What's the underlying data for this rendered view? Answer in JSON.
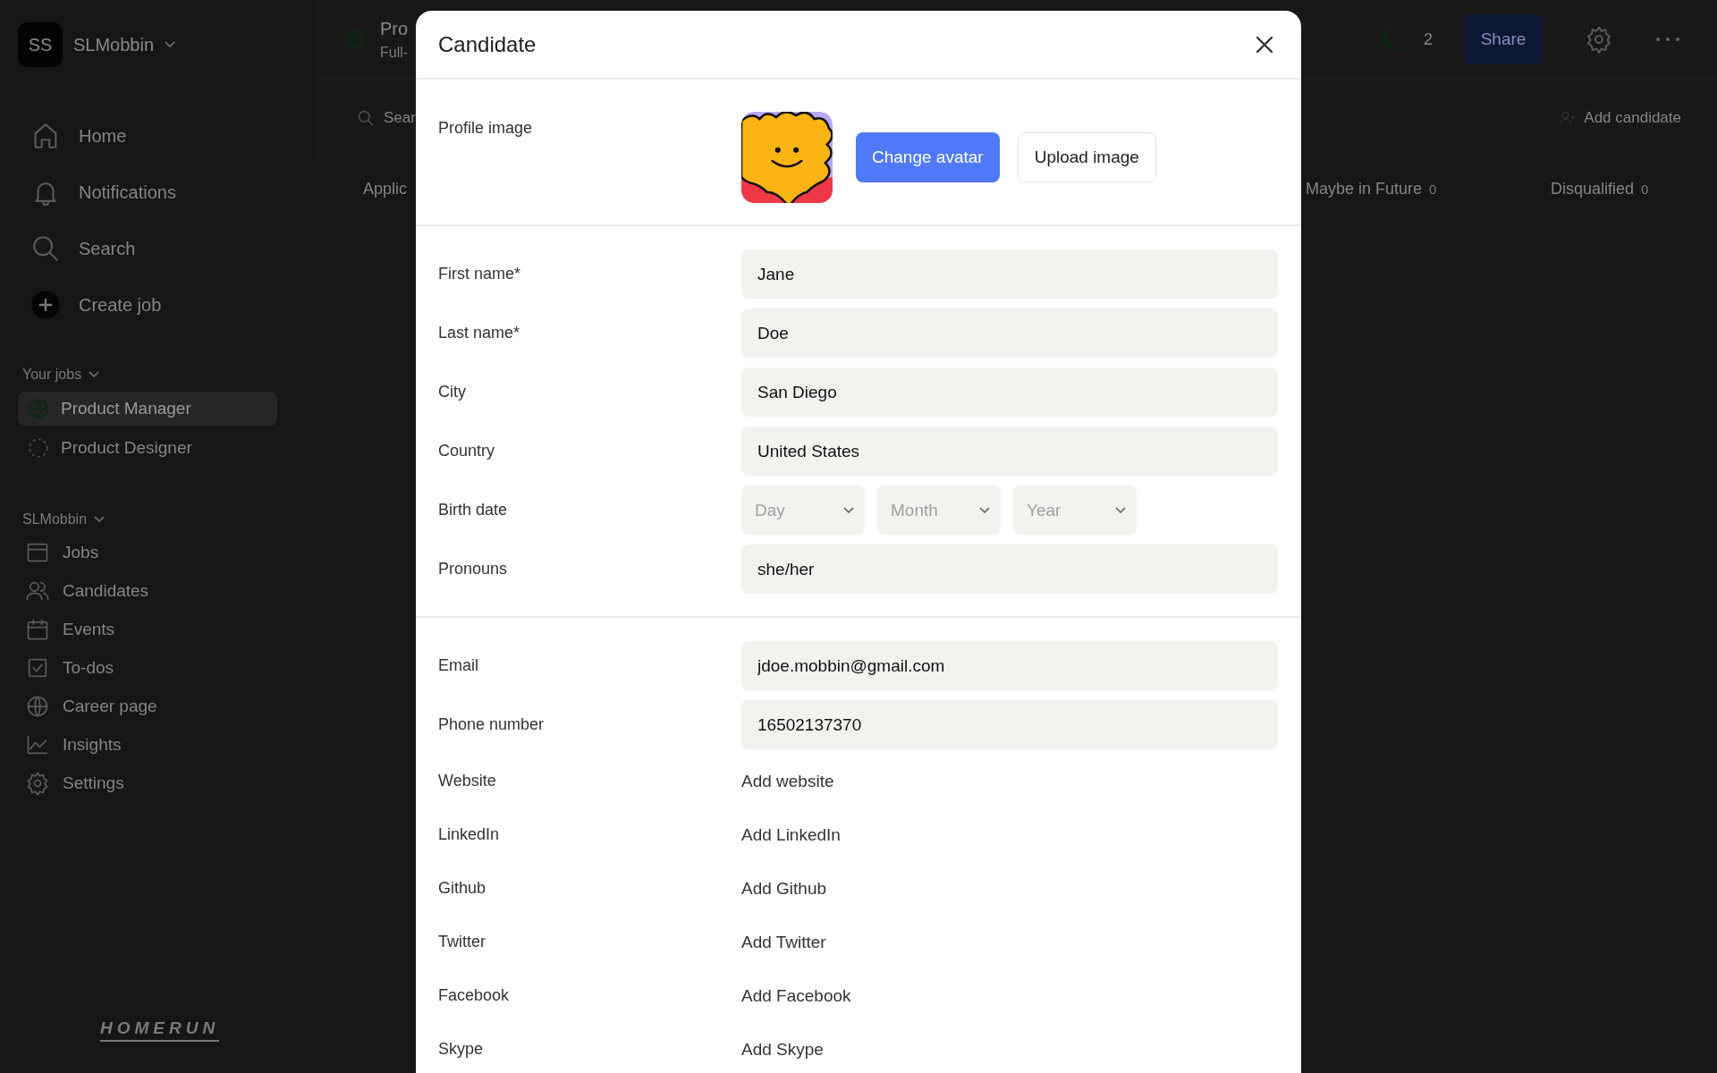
{
  "sidebar": {
    "workspace": {
      "initials": "SS",
      "name": "SLMobbin"
    },
    "nav": [
      {
        "label": "Home"
      },
      {
        "label": "Notifications"
      },
      {
        "label": "Search"
      },
      {
        "label": "Create job"
      }
    ],
    "jobs_heading": "Your jobs",
    "jobs": [
      {
        "title": "Product Manager",
        "selected": true
      },
      {
        "title": "Product Designer",
        "selected": false
      }
    ],
    "org_heading": "SLMobbin",
    "org_nav": [
      {
        "label": "Jobs"
      },
      {
        "label": "Candidates"
      },
      {
        "label": "Events"
      },
      {
        "label": "To-dos"
      },
      {
        "label": "Career page"
      },
      {
        "label": "Insights"
      },
      {
        "label": "Settings"
      }
    ],
    "brand": "HOMERUN"
  },
  "header": {
    "job_title": "Pro",
    "job_subtitle": "Full-",
    "badge_count": "2",
    "share": "Share"
  },
  "toolbar": {
    "search_placeholder": "Sear",
    "add_candidate": "Add candidate"
  },
  "columns": [
    {
      "label": "Applic"
    },
    {
      "label": "Maybe in Future",
      "count": "0"
    },
    {
      "label": "Disqualified",
      "count": "0"
    }
  ],
  "modal": {
    "title": "Candidate",
    "profile_label": "Profile image",
    "change_avatar": "Change avatar",
    "upload_image": "Upload image",
    "sections": [
      [
        {
          "kind": "text",
          "label": "First name*",
          "value": "Jane"
        },
        {
          "kind": "text",
          "label": "Last name*",
          "value": "Doe"
        },
        {
          "kind": "text",
          "label": "City",
          "value": "San Diego"
        },
        {
          "kind": "text",
          "label": "Country",
          "value": "United States"
        },
        {
          "kind": "date",
          "label": "Birth date",
          "parts": [
            {
              "placeholder": "Day"
            },
            {
              "placeholder": "Month"
            },
            {
              "placeholder": "Year"
            }
          ]
        },
        {
          "kind": "text",
          "label": "Pronouns",
          "value": "she/her"
        }
      ],
      [
        {
          "kind": "text",
          "label": "Email",
          "value": "jdoe.mobbin@gmail.com"
        },
        {
          "kind": "text",
          "label": "Phone number",
          "value": "16502137370"
        },
        {
          "kind": "link",
          "label": "Website",
          "action": "Add website"
        },
        {
          "kind": "link",
          "label": "LinkedIn",
          "action": "Add LinkedIn"
        },
        {
          "kind": "link",
          "label": "Github",
          "action": "Add Github"
        },
        {
          "kind": "link",
          "label": "Twitter",
          "action": "Add Twitter"
        },
        {
          "kind": "link",
          "label": "Facebook",
          "action": "Add Facebook"
        },
        {
          "kind": "link",
          "label": "Skype",
          "action": "Add Skype"
        }
      ]
    ]
  }
}
